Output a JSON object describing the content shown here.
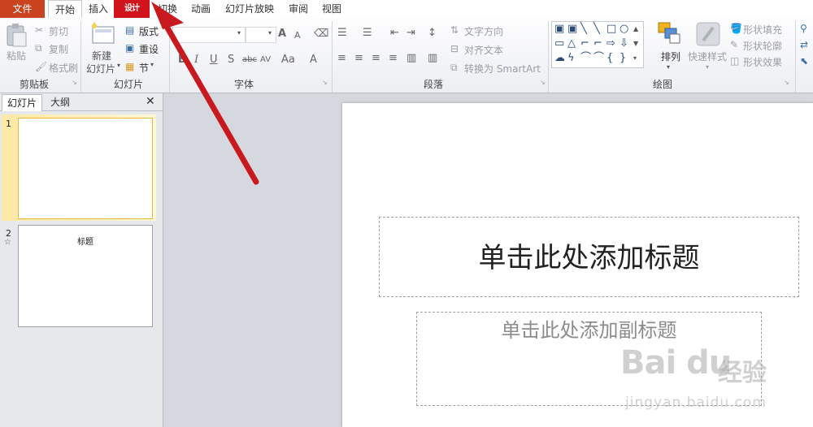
{
  "tabs": {
    "file": "文件",
    "home": "开始",
    "insert": "插入",
    "design": "设计",
    "transitions": "切换",
    "animations": "动画",
    "slideshow": "幻灯片放映",
    "review": "审阅",
    "view": "视图"
  },
  "ribbon": {
    "clipboard": {
      "paste": "粘贴",
      "cut": "剪切",
      "copy": "复制",
      "format_painter": "格式刷",
      "group_label": "剪贴板"
    },
    "slides": {
      "new_slide_line1": "新建",
      "new_slide_line2": "幻灯片",
      "layout": "版式",
      "reset": "重设",
      "section": "节",
      "group_label": "幻灯片"
    },
    "font": {
      "bold": "B",
      "italic": "I",
      "underline": "U",
      "shadow": "S",
      "strikethrough": "abc",
      "spacing": "AV",
      "case": "Aa",
      "color": "A",
      "grow": "A",
      "shrink": "A",
      "group_label": "字体"
    },
    "paragraph": {
      "text_direction": "文字方向",
      "align_text": "对齐文本",
      "smartart": "转换为 SmartArt",
      "group_label": "段落"
    },
    "drawing": {
      "arrange": "排列",
      "quick_styles": "快速样式",
      "shape_fill": "形状填充",
      "shape_outline": "形状轮廓",
      "shape_effects": "形状效果",
      "group_label": "绘图"
    }
  },
  "pane": {
    "tab_slides": "幻灯片",
    "tab_outline": "大纲",
    "close": "✕",
    "thumbnails": [
      {
        "number": "1",
        "title": ""
      },
      {
        "number": "2",
        "title": "标题"
      }
    ]
  },
  "slide": {
    "title_placeholder": "单击此处添加标题",
    "subtitle_placeholder": "单击此处添加副标题"
  },
  "watermark": {
    "logo": "Bai du",
    "cn": "经验",
    "url": "jingyan.baidu.com"
  },
  "colors": {
    "file_tab": "#c9441e",
    "design_tab_highlight": "#d1141b",
    "arrow": "#c8191f"
  }
}
